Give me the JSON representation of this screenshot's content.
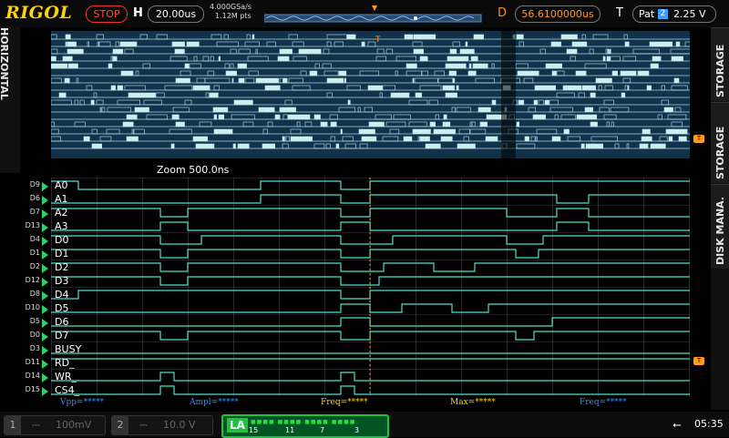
{
  "brand": "RIGOL",
  "run_state": "STOP",
  "horizontal": {
    "label": "H",
    "timebase": "20.00us",
    "sample_rate": "4.000GSa/s",
    "memory_depth": "1.12M pts"
  },
  "delay": {
    "label": "D",
    "value": "56.6100000us"
  },
  "trigger": {
    "label": "T",
    "mode": "Pat",
    "source": "2",
    "level": "2.25 V"
  },
  "left_menu": {
    "label": "HORIZONTAL"
  },
  "right_menu": {
    "items": [
      "STORAGE",
      "STORAGE",
      "DISK MANA."
    ]
  },
  "zoom": {
    "label": "Zoom  500.0ns"
  },
  "channels": [
    {
      "num": "D9",
      "name": "A0"
    },
    {
      "num": "D6",
      "name": "A1"
    },
    {
      "num": "D7",
      "name": "A2"
    },
    {
      "num": "D13",
      "name": "A3"
    },
    {
      "num": "D4",
      "name": "D0"
    },
    {
      "num": "D1",
      "name": "D1"
    },
    {
      "num": "D2",
      "name": "D2"
    },
    {
      "num": "D12",
      "name": "D3"
    },
    {
      "num": "D8",
      "name": "D4"
    },
    {
      "num": "D10",
      "name": "D5"
    },
    {
      "num": "D5",
      "name": "D6"
    },
    {
      "num": "D0",
      "name": "D7"
    },
    {
      "num": "D3",
      "name": "BUSY"
    },
    {
      "num": "D11",
      "name": "RD_"
    },
    {
      "num": "D14",
      "name": "WR_"
    },
    {
      "num": "D15",
      "name": "CS4_"
    }
  ],
  "measurements": [
    {
      "text": "Vpp=*****",
      "color": "#3a8cff"
    },
    {
      "text": "Ampl=*****",
      "color": "#3a8cff"
    },
    {
      "text": "Freq=*****",
      "color": "#ffd400"
    },
    {
      "text": "Max=*****",
      "color": "#ffd400"
    },
    {
      "text": "Freq=*****",
      "color": "#3a8cff"
    }
  ],
  "bottom": {
    "ch1": {
      "num": "1",
      "scale": "100mV"
    },
    "ch2": {
      "num": "2",
      "scale": "10.0 V"
    },
    "la": {
      "label": "LA",
      "bit_labels": [
        "15",
        "11",
        "7",
        "3"
      ]
    },
    "time": "05:35"
  },
  "colors": {
    "trace": "#4ee0c8",
    "accent": "#ff9a1a",
    "brand": "#ffd400",
    "la": "#20c040"
  }
}
